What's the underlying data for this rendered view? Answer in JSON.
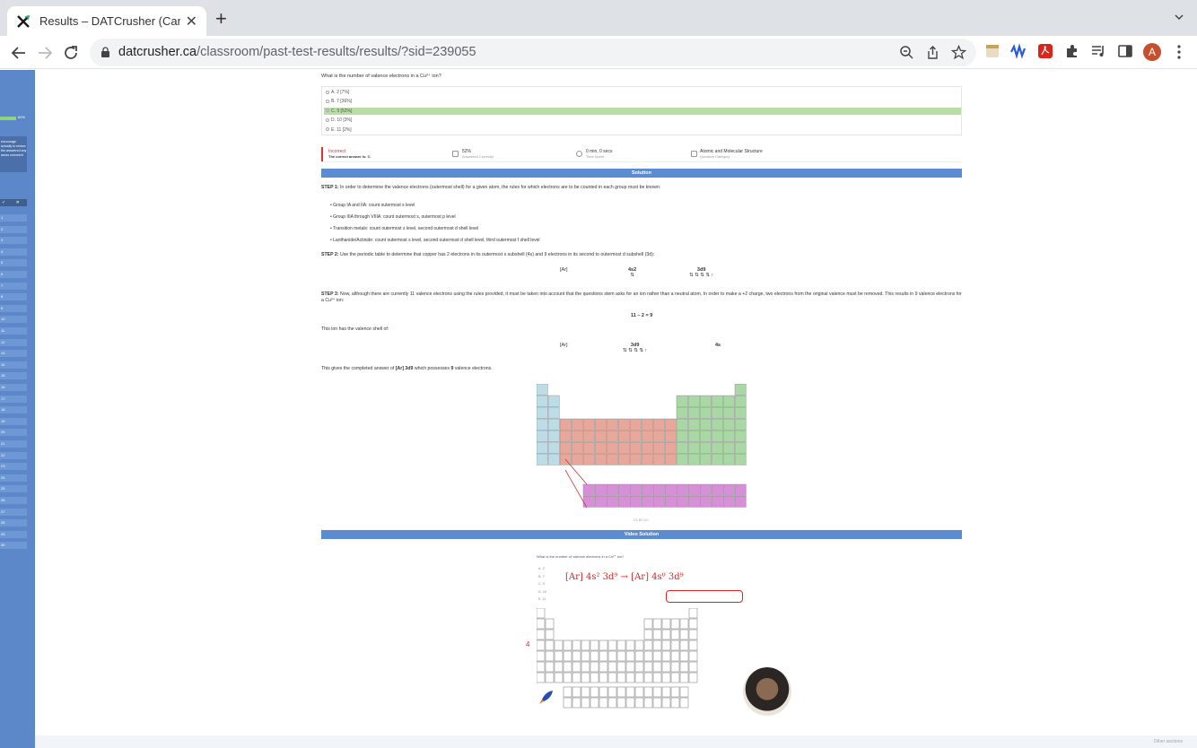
{
  "browser": {
    "tab_title": "Results – DATCrusher (Canadia",
    "url_domain": "datcrusher.ca",
    "url_path": "/classroom/past-test-results/results/?sid=239055",
    "avatar_letter": "A"
  },
  "sidebar": {
    "progress_label": "60%",
    "note_text": "encourage actually to review the answered any areas comment",
    "head_left": "✓",
    "head_right": "✕",
    "rows": [
      "1",
      "2",
      "3",
      "4",
      "5",
      "6",
      "7",
      "8",
      "9",
      "10",
      "11",
      "12",
      "13",
      "14",
      "15",
      "16",
      "17",
      "18",
      "19",
      "20",
      "21",
      "22",
      "23",
      "24",
      "25",
      "26",
      "27",
      "28",
      "29",
      "30"
    ]
  },
  "question": {
    "text": "What is the number of valence electrons in a Cu²⁺ ion?",
    "answers": [
      {
        "label": "A. 2 [7%]",
        "correct": false
      },
      {
        "label": "B. 7 [36%]",
        "correct": false
      },
      {
        "label": "C. 9 [52%]",
        "correct": true
      },
      {
        "label": "D. 10 [3%]",
        "correct": false
      },
      {
        "label": "E. 11 [2%]",
        "correct": false
      }
    ]
  },
  "stats": {
    "result": "Incorrect",
    "correct_answer": "The correct answer is: C.",
    "percent": "52%",
    "percent_label": "Answered Correctly",
    "time": "0 min, 0 secs",
    "time_label": "Time Spent",
    "category": "Atomic and Molecular Structure",
    "category_label": "Question Category"
  },
  "solution": {
    "header": "Solution",
    "step1_label": "STEP 1:",
    "step1_text": " In order to determine the valence electrons (outermost shell) for a given atom, the rules for which electrons are to be counted in each group must be known:",
    "bullets": [
      "• Group IA and IIA: count outermost s level",
      "• Group IIIA through VIIIA: count outermost s, outermost p level",
      "• Transition metals: count outermost s level, second outermost d shell level",
      "• Lanthanide/Actinide: count outermost s level, second outermost d shell level, third outermost f shell level"
    ],
    "step2_label": "STEP 2:",
    "step2_text": " Use the periodic table to determine that copper has 2 electrons in its outermost s subshell (4s) and 9 electrons in its second to outermost d subshell (3d):",
    "config1": {
      "core": "[Ar]",
      "s": "4s2",
      "s_arrows": "⇅",
      "d": "3d9",
      "d_arrows": "⇅ ⇅ ⇅ ⇅ ↑"
    },
    "step3_label": "STEP 3:",
    "step3_text": " Now, although there are currently 11 valence electrons using the rules provided, it must be taken into account that the questions stem asks for an ion rather than a neutral atom. In order to make a +2 charge, two electrons from the original valence must be removed. This results in 9 valence electrons for a Cu²⁺ ion:",
    "equation": "11 – 2 = 9",
    "shell_text": "This ion has the valence shell of:",
    "config2": {
      "core": "[Ar]",
      "d": "3d9",
      "d_arrows": "⇅ ⇅ ⇅ ⇅ ↑",
      "s": "4s"
    },
    "final_pre": "This gives the completed answer of ",
    "final_config": "[Ar] 3d9",
    "final_mid": " which possesses ",
    "final_num": "9",
    "final_post": " valence electrons.",
    "pt_caption": "CC BY 4.0"
  },
  "video": {
    "header": "Video Solution",
    "question": "What is the number of valence electrons in a Cu²⁺ ion?",
    "options": [
      "A. 2",
      "B. 7",
      "C. 9",
      "D. 10",
      "E. 11"
    ],
    "handwriting1": "[Ar] 4s² 3d⁹ → [Ar] 4s⁰ 3d⁹",
    "row_mark": "4"
  },
  "footer": {
    "text": "Other sections"
  },
  "colors": {
    "accent": "#5b8bd0",
    "sidebar": "#5c87c9",
    "correct": "#b9dda5",
    "incorrect": "#e03030"
  }
}
